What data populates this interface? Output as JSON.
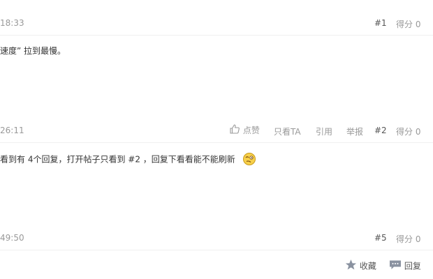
{
  "posts": [
    {
      "time": "18:33",
      "floor": "#1",
      "score": "得分 0",
      "content": "速度” 拉到最慢。"
    },
    {
      "time": "26:11",
      "floor": "#2",
      "score": "得分 0",
      "actions": {
        "like": "点赞",
        "only_author": "只看TA",
        "quote": "引用",
        "report": "举报"
      },
      "content": "看到有 4个回复，打开帖子只看到 #2 ，回复下看看能不能刷新"
    },
    {
      "time": "49:50",
      "floor": "#5",
      "score": "得分 0"
    }
  ],
  "footer": {
    "favorite": "收藏",
    "reply": "回复"
  },
  "icons": {
    "thumb": "thumbs-up-icon",
    "emoji": "confused-emoji-icon",
    "star": "star-icon",
    "comment": "comment-icon"
  }
}
